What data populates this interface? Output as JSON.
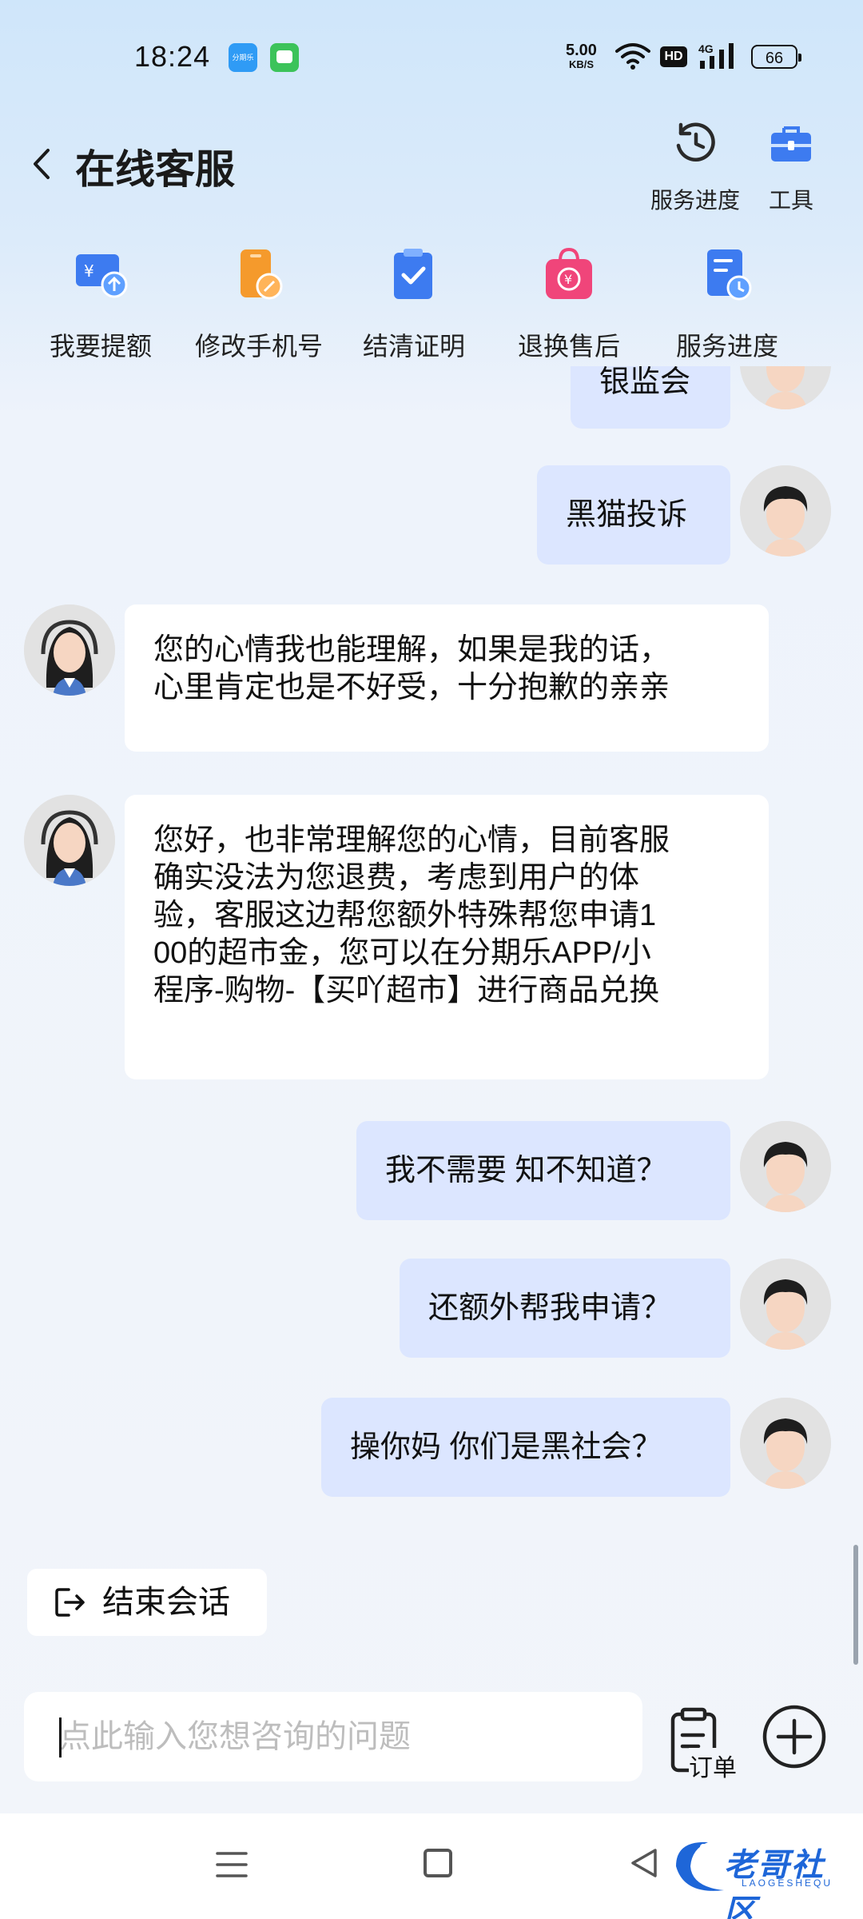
{
  "status_bar": {
    "time": "18:24",
    "notification_app": "分期乐",
    "net_speed_value": "5.00",
    "net_speed_unit": "KB/S",
    "hd_label": "HD",
    "network_label": "4G",
    "battery": "66"
  },
  "header": {
    "title": "在线客服",
    "actions": [
      {
        "label": "服务进度",
        "icon": "clock-history-icon"
      },
      {
        "label": "工具",
        "icon": "toolbox-icon"
      }
    ]
  },
  "quick_actions": [
    {
      "label": "我要提额",
      "icon": "wallet-up-icon",
      "color": "#3D7BF0"
    },
    {
      "label": "修改手机号",
      "icon": "phone-edit-icon",
      "color": "#F59A2C"
    },
    {
      "label": "结清证明",
      "icon": "clipboard-check-icon",
      "color": "#3D7BF0"
    },
    {
      "label": "退换售后",
      "icon": "shopping-bag-icon",
      "color": "#F0457A"
    },
    {
      "label": "服务进度",
      "icon": "document-clock-icon",
      "color": "#3D7BF0"
    }
  ],
  "messages": [
    {
      "sender": "user",
      "text": "银监会"
    },
    {
      "sender": "user",
      "text": "黑猫投诉"
    },
    {
      "sender": "agent",
      "lines": [
        "您的心情我也能理解，如果是我的话，",
        "心里肯定也是不好受，十分抱歉的亲亲"
      ]
    },
    {
      "sender": "agent",
      "lines": [
        "您好，也非常理解您的心情，目前客服",
        "确实没法为您退费，考虑到用户的体",
        "验，客服这边帮您额外特殊帮您申请1",
        "00的超市金，您可以在分期乐APP/小",
        "程序-购物-【买吖超市】进行商品兑换"
      ]
    },
    {
      "sender": "user",
      "text": "我不需要 知不知道？"
    },
    {
      "sender": "user",
      "text": "还额外帮我申请？"
    },
    {
      "sender": "user",
      "text": "操你妈 你们是黑社会？"
    }
  ],
  "end_chat_label": "结束会话",
  "input": {
    "placeholder": "点此输入您想咨询的问题",
    "value": ""
  },
  "order_label": "订单",
  "watermark": {
    "text": "老哥社区",
    "sub": "LAOGESHEQU"
  },
  "colors": {
    "accent": "#3D7BF0",
    "user_bubble": "#DCE6FF",
    "agent_bubble": "#FFFFFF"
  }
}
